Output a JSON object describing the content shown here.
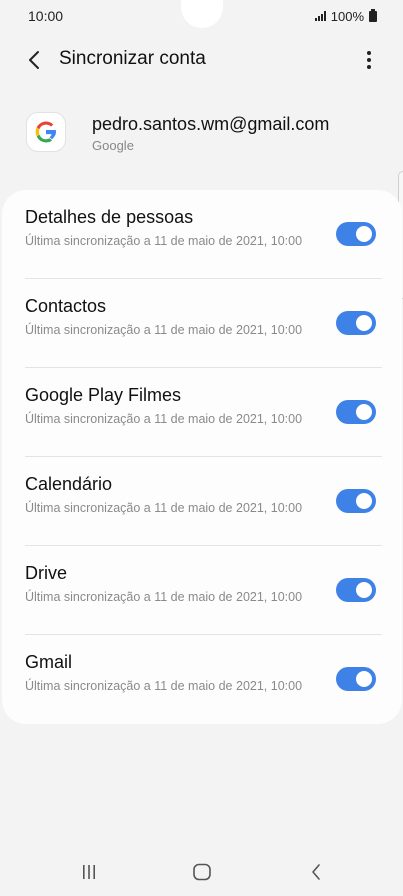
{
  "status_bar": {
    "time": "10:00",
    "battery": "100%",
    "signal_icon": "signal-icon",
    "battery_icon": "battery-icon"
  },
  "header": {
    "title": "Sincronizar conta",
    "back_icon": "back-arrow-icon",
    "more_icon": "more-vertical-icon"
  },
  "account": {
    "email": "pedro.santos.wm@gmail.com",
    "type": "Google",
    "logo_icon": "google-logo-icon"
  },
  "sync_items": [
    {
      "title": "Detalhes de pessoas",
      "subtitle": "Última sincronização a 11 de maio de 2021, 10:00",
      "enabled": true
    },
    {
      "title": "Contactos",
      "subtitle": "Última sincronização a 11 de maio de 2021, 10:00",
      "enabled": true
    },
    {
      "title": "Google Play Filmes",
      "subtitle": "Última sincronização a 11 de maio de 2021, 10:00",
      "enabled": true
    },
    {
      "title": "Calendário",
      "subtitle": "Última sincronização a 11 de maio de 2021, 10:00",
      "enabled": true
    },
    {
      "title": "Drive",
      "subtitle": "Última sincronização a 11 de maio de 2021, 10:00",
      "enabled": true
    },
    {
      "title": "Gmail",
      "subtitle": "Última sincronização a 11 de maio de 2021, 10:00",
      "enabled": true
    }
  ],
  "nav": {
    "recents_icon": "recents-icon",
    "home_icon": "home-icon",
    "back_icon": "nav-back-icon"
  },
  "colors": {
    "toggle_on": "#3e82e8",
    "background": "#f3f3f3",
    "card": "#fdfdfd"
  }
}
